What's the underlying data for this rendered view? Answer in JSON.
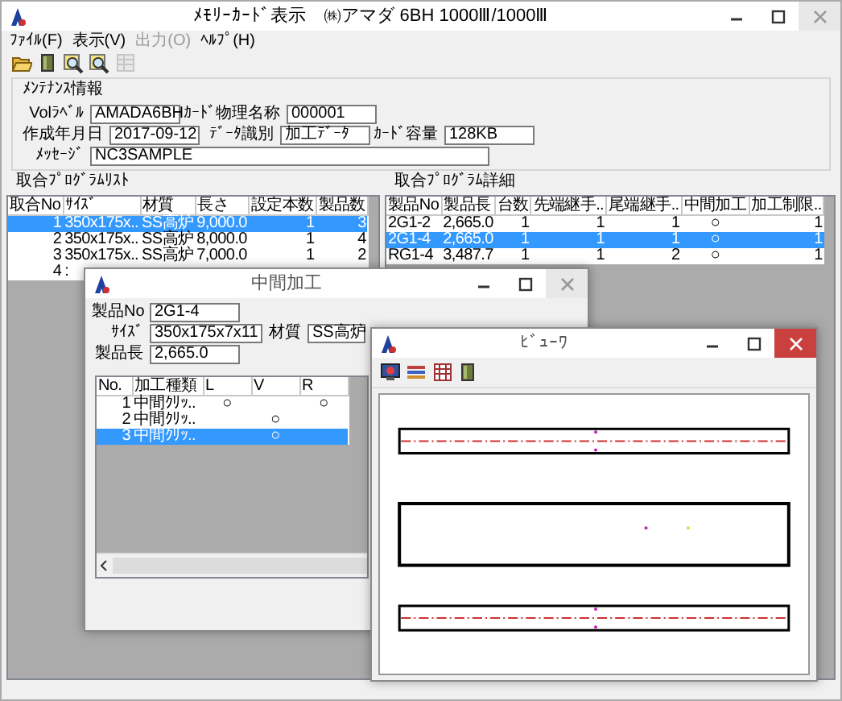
{
  "main_window": {
    "title": "ﾒﾓﾘｰｶｰﾄﾞ表示　㈱アマダ 6BH 1000Ⅲ/1000Ⅲ",
    "menu": [
      {
        "label": "ﾌｧｲﾙ(F)",
        "disabled": false
      },
      {
        "label": "表示(V)",
        "disabled": false
      },
      {
        "label": "出力(O)",
        "disabled": true
      },
      {
        "label": "ﾍﾙﾌﾟ(H)",
        "disabled": false
      }
    ],
    "toolbar": [
      {
        "kind": "folder",
        "disabled": false
      },
      {
        "kind": "book",
        "disabled": false
      },
      {
        "kind": "magnifier",
        "disabled": false
      },
      {
        "kind": "magnifier",
        "disabled": false
      },
      {
        "kind": "table",
        "disabled": true
      }
    ]
  },
  "maintenance": {
    "title": "ﾒﾝﾃﾅﾝｽ情報",
    "rows": [
      [
        {
          "label": "Volﾗﾍﾞﾙ",
          "value": "AMADA6BH"
        },
        {
          "label": "ｶｰﾄﾞ物理名称",
          "value": "000001"
        }
      ],
      [
        {
          "label": "作成年月日",
          "value": "2017-09-12"
        },
        {
          "label": "ﾃﾞｰﾀ識別",
          "value": "加工ﾃﾞｰﾀ"
        },
        {
          "label": "ｶｰﾄﾞ容量",
          "value": "128KB"
        }
      ],
      [
        {
          "label": "ﾒｯｾｰｼﾞ",
          "value": "NC3SAMPLE"
        }
      ]
    ]
  },
  "program_list": {
    "title": "取合ﾌﾟﾛｸﾞﾗﾑﾘｽﾄ",
    "columns": [
      "取合No",
      "ｻｲｽﾞ",
      "材質",
      "長さ",
      "設定本数",
      "製品数"
    ],
    "rows": [
      {
        "cells": [
          "1",
          "350x175x..",
          "SS高炉",
          "9,000.0",
          "1",
          "3"
        ],
        "selected": true
      },
      {
        "cells": [
          "2",
          "350x175x..",
          "SS高炉",
          "8,000.0",
          "1",
          "4"
        ],
        "selected": false
      },
      {
        "cells": [
          "3",
          "350x175x..",
          "SS高炉",
          "7,000.0",
          "1",
          "2"
        ],
        "selected": false
      },
      {
        "cells": [
          "4",
          ":",
          "",
          "",
          "",
          ""
        ],
        "selected": false
      }
    ]
  },
  "program_detail": {
    "title": "取合ﾌﾟﾛｸﾞﾗﾑ詳細",
    "columns": [
      "製品No",
      "製品長",
      "台数",
      "先端継手..",
      "尾端継手..",
      "中間加工",
      "加工制限.."
    ],
    "rows": [
      {
        "cells": [
          "2G1-2",
          "2,665.0",
          "1",
          "1",
          "1",
          "○",
          "1"
        ],
        "selected": false
      },
      {
        "cells": [
          "2G1-4",
          "2,665.0",
          "1",
          "1",
          "1",
          "○",
          "1"
        ],
        "selected": true
      },
      {
        "cells": [
          "RG1-4",
          "3,487.7",
          "1",
          "1",
          "2",
          "○",
          "1"
        ],
        "selected": false
      }
    ]
  },
  "middle_window": {
    "title": "中間加工",
    "fields": [
      {
        "label": "製品No",
        "value": "2G1-4"
      },
      {
        "label": "ｻｲｽﾞ",
        "value": "350x175x7x11"
      },
      {
        "label": "材質",
        "value": "SS高炉"
      },
      {
        "label": "製品長",
        "value": "2,665.0"
      }
    ],
    "table": {
      "columns": [
        "No.",
        "加工種類",
        "L",
        "V",
        "R"
      ],
      "rows": [
        {
          "cells": [
            "1",
            "中間ｸﾘｯ..",
            "○",
            "",
            "○"
          ],
          "selected": false
        },
        {
          "cells": [
            "2",
            "中間ｸﾘｯ..",
            "",
            "○",
            ""
          ],
          "selected": false
        },
        {
          "cells": [
            "3",
            "中間ｸﾘｯ..",
            "",
            "○",
            ""
          ],
          "selected": true
        }
      ]
    }
  },
  "viewer_window": {
    "title": "ﾋﾞｭｰﾜ",
    "toolbar": [
      {
        "kind": "monitor"
      },
      {
        "kind": "bars"
      },
      {
        "kind": "grid"
      },
      {
        "kind": "book"
      }
    ]
  }
}
